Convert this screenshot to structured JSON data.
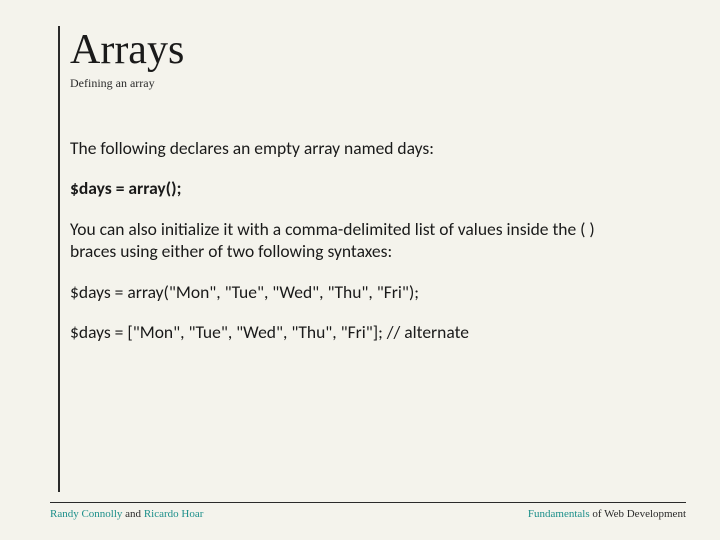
{
  "title": "Arrays",
  "subtitle": "Defining an array",
  "body": {
    "p1": "The following declares an empty array named days:",
    "code1": "$days = array();",
    "p2": "You can also initialize it with a comma-delimited list of values inside the ( ) braces using either of two following syntaxes:",
    "code2": "$days = array(\"Mon\", \"Tue\", \"Wed\", \"Thu\", \"Fri\");",
    "code3": "$days = [\"Mon\", \"Tue\", \"Wed\", \"Thu\", \"Fri\"]; // alternate"
  },
  "footer": {
    "author1": "Randy Connolly",
    "joiner": " and ",
    "author2": "Ricardo Hoar",
    "book1": "Fundamentals",
    "book2": " of Web Development"
  }
}
